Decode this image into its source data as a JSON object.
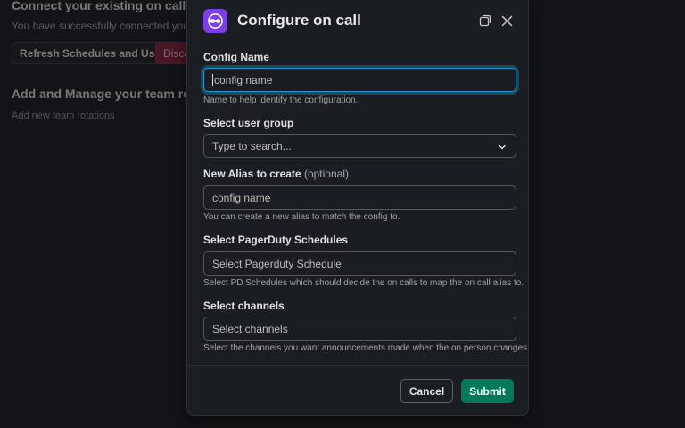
{
  "background": {
    "title": "Connect your existing on call system",
    "subtitle": "You have successfully connected your PagerDuty account",
    "refresh_button": "Refresh Schedules and Users",
    "disconnect_button": "Disconnect",
    "section_title": "Add and Manage your team rotations",
    "section_text": "Add new team rotations"
  },
  "modal": {
    "title": "Configure on call",
    "app_icon": "infinity-link-icon",
    "accent_color": "#7b3fe4",
    "fields": {
      "config_name": {
        "label": "Config Name",
        "placeholder": "config name",
        "hint": "Name to help identify the configuration."
      },
      "user_group": {
        "label": "Select user group",
        "placeholder": "Type to search..."
      },
      "alias": {
        "label": "New Alias to create",
        "optional": "(optional)",
        "placeholder": "config name",
        "hint": "You can create a new alias to match the config to."
      },
      "schedules": {
        "label": "Select PagerDuty Schedules",
        "placeholder": "Select Pagerduty Schedule",
        "hint": "Select PD Schedules which should decide the on calls to map the on call alias to."
      },
      "channels": {
        "label": "Select channels",
        "placeholder": "Select channels",
        "hint": "Select the channels you want announcements made when the on person changes."
      }
    },
    "cancel_label": "Cancel",
    "submit_label": "Submit",
    "submit_color": "#007a5a"
  }
}
